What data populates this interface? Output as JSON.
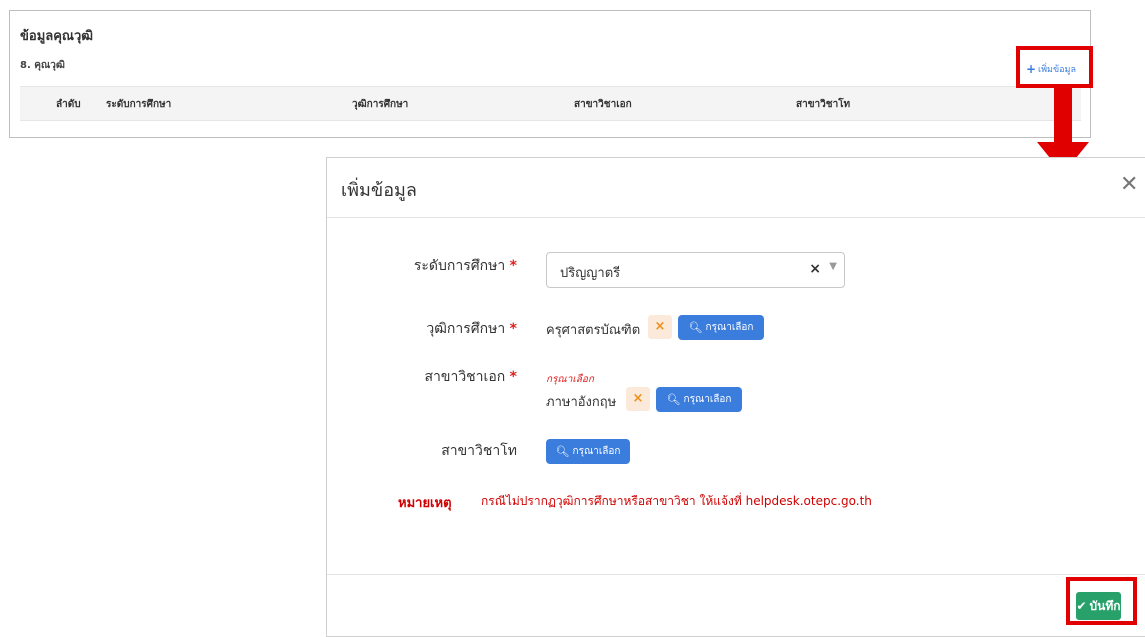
{
  "background_panel": {
    "section_title": "ข้อมูลคุณวุฒิ",
    "subsection_title": "8. คุณวุฒิ",
    "add_link_label": "เพิ่มข้อมูล",
    "add_link_icon": "plus-icon",
    "table": {
      "columns": [
        "ลำดับ",
        "ระดับการศึกษา",
        "วุฒิการศึกษา",
        "สาขาวิชาเอก",
        "สาขาวิชาโท"
      ]
    }
  },
  "modal": {
    "title": "เพิ่มข้อมูล",
    "close_icon": "close-icon",
    "fields": {
      "education_level": {
        "label": "ระดับการศึกษา",
        "required_mark": "*",
        "value": "ปริญญาตรี",
        "clear_symbol": "×",
        "caret_symbol": "▼"
      },
      "degree": {
        "label": "วุฒิการศึกษา",
        "required_mark": "*",
        "value": "ครุศาสตรบัณฑิต",
        "clear_symbol": "×",
        "pick_label": "กรุณาเลือก",
        "pick_icon": "search-icon"
      },
      "major": {
        "label": "สาขาวิชาเอก",
        "required_mark": "*",
        "hint": "กรุณาเลือก",
        "value": "ภาษาอังกฤษ",
        "clear_symbol": "×",
        "pick_label": "กรุณาเลือก",
        "pick_icon": "search-icon"
      },
      "minor": {
        "label": "สาขาวิชาโท",
        "pick_label": "กรุณาเลือก",
        "pick_icon": "search-icon"
      }
    },
    "note": {
      "label": "หมายเหตุ",
      "text": "กรณีไม่ปรากฏวุฒิการศึกษาหรือสาขาวิชา ให้แจ้งที่ helpdesk.otepc.go.th"
    },
    "save_button": {
      "label": "บันทึก",
      "icon": "check-icon"
    }
  },
  "colors": {
    "highlight": "#e00000",
    "primary": "#3b7ddd",
    "success": "#27a06a",
    "required": "#e02020",
    "clear_bg": "#fbead9",
    "clear_fg": "#ef8f1b"
  }
}
